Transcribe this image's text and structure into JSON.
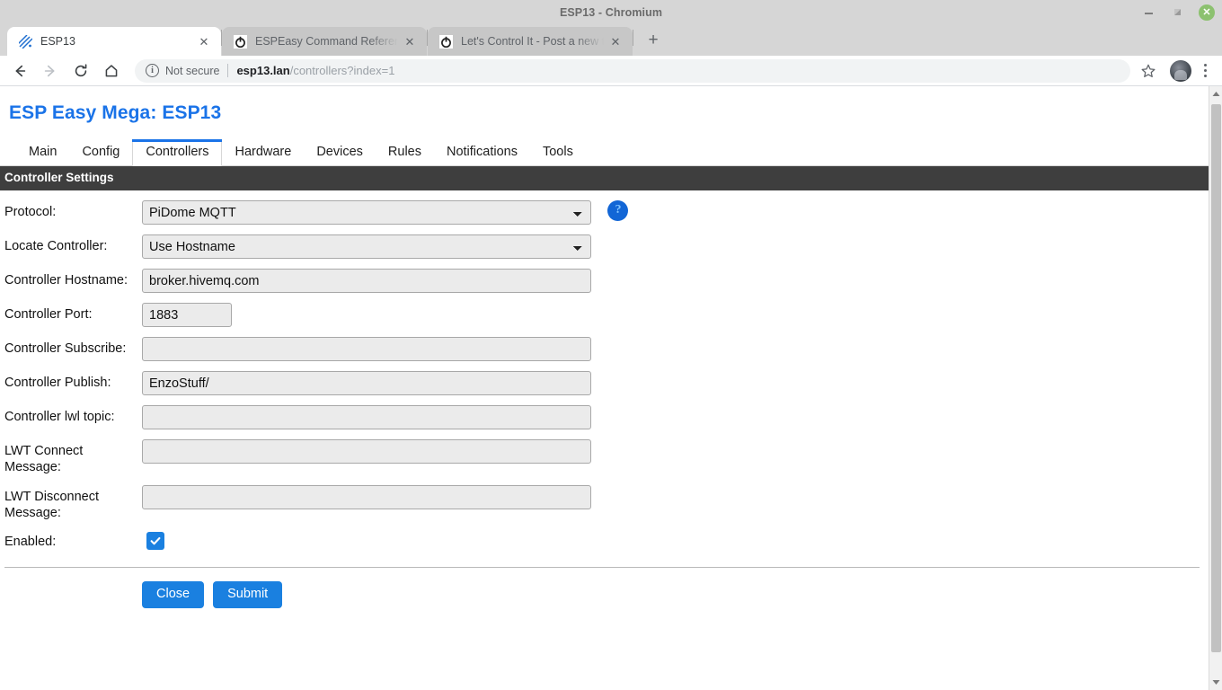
{
  "window": {
    "title": "ESP13 - Chromium",
    "controls": {
      "minimize": "minimize-icon",
      "maximize": "maximize-icon",
      "close": "✕"
    }
  },
  "tabs": [
    {
      "title": "ESP13",
      "favicon": "esp-easy-logo-icon",
      "active": true,
      "close": "✕"
    },
    {
      "title": "ESPEasy Command Reference -",
      "favicon": "power-button-icon",
      "active": false,
      "close": "✕"
    },
    {
      "title": "Let's Control It - Post a new topi",
      "favicon": "power-button-icon",
      "active": false,
      "close": "✕"
    }
  ],
  "newtab_label": "+",
  "toolbar": {
    "back": "back-arrow-icon",
    "forward": "forward-arrow-icon",
    "reload": "reload-icon",
    "home": "home-icon",
    "security_info": "i",
    "security_text": "Not secure",
    "url_host": "esp13.lan",
    "url_path": "/controllers?index=1",
    "bookmark": "star-icon",
    "profile": "avatar",
    "menu": "three-dot-menu-icon"
  },
  "page": {
    "site_title": "ESP Easy Mega: ESP13",
    "nav_tabs": [
      {
        "label": "Main",
        "active": false
      },
      {
        "label": "Config",
        "active": false
      },
      {
        "label": "Controllers",
        "active": true
      },
      {
        "label": "Hardware",
        "active": false
      },
      {
        "label": "Devices",
        "active": false
      },
      {
        "label": "Rules",
        "active": false
      },
      {
        "label": "Notifications",
        "active": false
      },
      {
        "label": "Tools",
        "active": false
      }
    ],
    "section_header": "Controller Settings",
    "fields": {
      "protocol": {
        "label": "Protocol:",
        "value": "PiDome MQTT",
        "help": "?"
      },
      "locate_controller": {
        "label": "Locate Controller:",
        "value": "Use Hostname"
      },
      "controller_hostname": {
        "label": "Controller Hostname:",
        "value": "broker.hivemq.com"
      },
      "controller_port": {
        "label": "Controller Port:",
        "value": "1883"
      },
      "controller_subscribe": {
        "label": "Controller Subscribe:",
        "value": ""
      },
      "controller_publish": {
        "label": "Controller Publish:",
        "value": "EnzoStuff/"
      },
      "controller_lwl_topic": {
        "label": "Controller lwl topic:",
        "value": ""
      },
      "lwt_connect_message": {
        "label": "LWT Connect Message:",
        "value": ""
      },
      "lwt_disconnect_message": {
        "label": "LWT Disconnect Message:",
        "value": ""
      },
      "enabled": {
        "label": "Enabled:",
        "checked": true
      }
    },
    "buttons": {
      "close": "Close",
      "submit": "Submit"
    }
  },
  "colors": {
    "accent": "#1a80e0",
    "link": "#1a73e8",
    "section_header_bg": "#3e3e3e",
    "field_bg": "#ebebeb",
    "tabstrip_bg": "#d6d6d6"
  }
}
